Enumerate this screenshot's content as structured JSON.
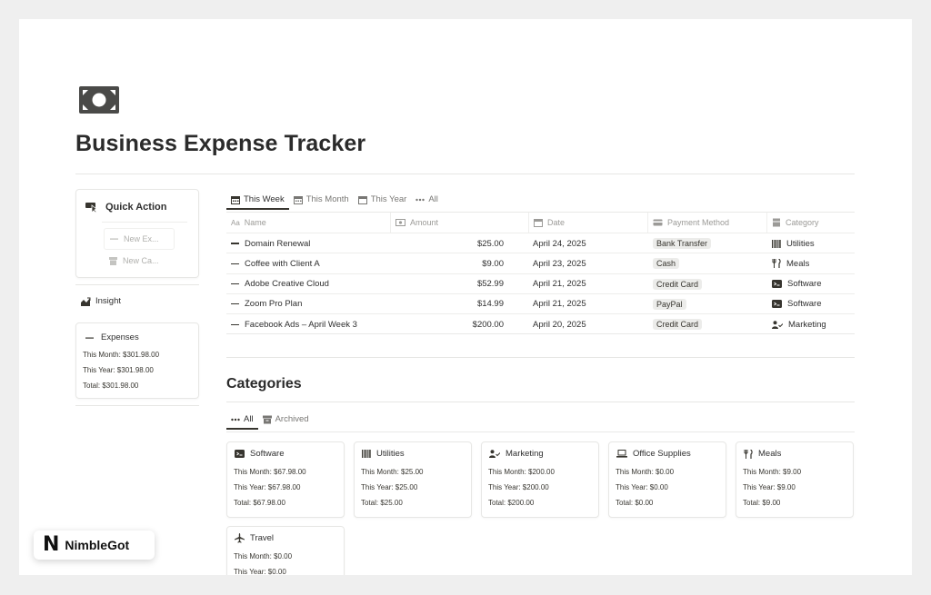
{
  "page": {
    "title": "Business Expense Tracker",
    "icon": "money-bill-icon"
  },
  "quick_action": {
    "label": "Quick Action",
    "buttons": [
      {
        "label": "New Ex...",
        "icon": "minus-icon"
      },
      {
        "label": "New Ca...",
        "icon": "archive-box-icon"
      }
    ]
  },
  "insight": {
    "label": "Insight",
    "expenses": {
      "title": "Expenses",
      "this_month": "This Month: $301.98.00",
      "this_year": "This Year: $301.98.00",
      "total": "Total: $301.98.00"
    }
  },
  "view_tabs": [
    {
      "label": "This Week",
      "icon": "calendar-icon",
      "active": true
    },
    {
      "label": "This Month",
      "icon": "calendar-icon",
      "active": false
    },
    {
      "label": "This Year",
      "icon": "calendar-icon",
      "active": false
    },
    {
      "label": "All",
      "icon": "more-horizontal-icon",
      "active": false
    }
  ],
  "table": {
    "columns": [
      {
        "label": "Name",
        "icon": "text-icon"
      },
      {
        "label": "Amount",
        "icon": "money-icon"
      },
      {
        "label": "Date",
        "icon": "calendar-icon"
      },
      {
        "label": "Payment Method",
        "icon": "card-icon"
      },
      {
        "label": "Category",
        "icon": "relation-icon"
      }
    ],
    "rows": [
      {
        "name": "Domain Renewal",
        "amount": "$25.00",
        "date": "April 24, 2025",
        "payment": "Bank Transfer",
        "category": "Utilities",
        "category_icon": "barcode-icon"
      },
      {
        "name": "Coffee with Client A",
        "amount": "$9.00",
        "date": "April 23, 2025",
        "payment": "Cash",
        "category": "Meals",
        "category_icon": "fork-knife-icon"
      },
      {
        "name": "Adobe Creative Cloud",
        "amount": "$52.99",
        "date": "April 21, 2025",
        "payment": "Credit Card",
        "category": "Software",
        "category_icon": "software-icon"
      },
      {
        "name": "Zoom Pro Plan",
        "amount": "$14.99",
        "date": "April 21, 2025",
        "payment": "PayPal",
        "category": "Software",
        "category_icon": "software-icon"
      },
      {
        "name": "Facebook Ads – April Week 3",
        "amount": "$200.00",
        "date": "April 20, 2025",
        "payment": "Credit Card",
        "category": "Marketing",
        "category_icon": "person-check-icon"
      }
    ]
  },
  "categories": {
    "heading": "Categories",
    "tabs": [
      {
        "label": "All",
        "icon": "more-horizontal-icon",
        "active": true
      },
      {
        "label": "Archived",
        "icon": "archive-box-icon",
        "active": false
      }
    ],
    "cards": [
      {
        "name": "Software",
        "icon": "software-icon",
        "this_month": "This Month: $67.98.00",
        "this_year": "This Year: $67.98.00",
        "total": "Total: $67.98.00"
      },
      {
        "name": "Utilities",
        "icon": "barcode-icon",
        "this_month": "This Month: $25.00",
        "this_year": "This Year: $25.00",
        "total": "Total: $25.00"
      },
      {
        "name": "Marketing",
        "icon": "person-check-icon",
        "this_month": "This Month: $200.00",
        "this_year": "This Year: $200.00",
        "total": "Total: $200.00"
      },
      {
        "name": "Office Supplies",
        "icon": "laptop-icon",
        "this_month": "This Month: $0.00",
        "this_year": "This Year: $0.00",
        "total": "Total: $0.00"
      },
      {
        "name": "Meals",
        "icon": "fork-knife-icon",
        "this_month": "This Month: $9.00",
        "this_year": "This Year: $9.00",
        "total": "Total: $9.00"
      },
      {
        "name": "Travel",
        "icon": "airplane-icon",
        "this_month": "This Month: $0.00",
        "this_year": "This Year: $0.00",
        "total": ""
      }
    ]
  },
  "brand": {
    "logo_letter": "N",
    "name": "NimbleGot"
  }
}
